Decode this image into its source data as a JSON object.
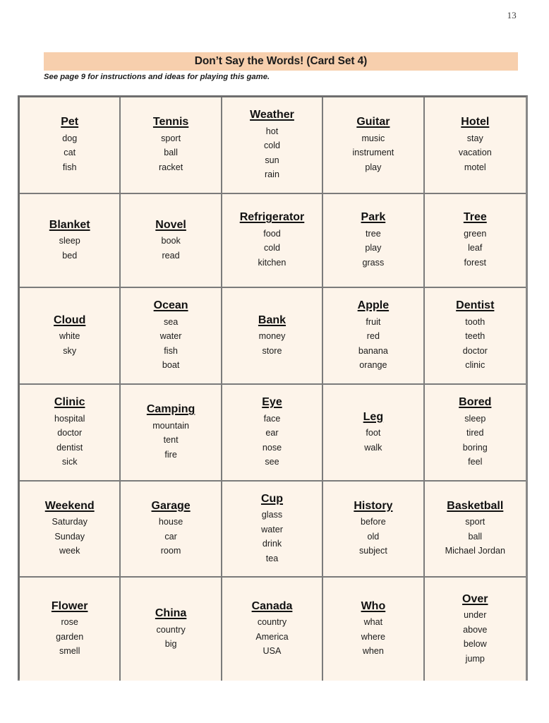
{
  "page": {
    "number": "13",
    "title": "Don’t Say the Words! (Card Set 4)",
    "subtitle": "See page 9 for instructions and ideas for playing this game.",
    "banner_color": "#f7cfad",
    "card_background": "#fdf4ea",
    "border_color": "#7b7b7b"
  },
  "cards": [
    {
      "title": "Pet",
      "words": [
        "dog",
        "cat",
        "fish"
      ]
    },
    {
      "title": "Tennis",
      "words": [
        "sport",
        "ball",
        "racket"
      ]
    },
    {
      "title": "Weather",
      "words": [
        "hot",
        "cold",
        "sun",
        "rain"
      ]
    },
    {
      "title": "Guitar",
      "words": [
        "music",
        "instrument",
        "play"
      ]
    },
    {
      "title": "Hotel",
      "words": [
        "stay",
        "vacation",
        "motel"
      ]
    },
    {
      "title": "Blanket",
      "words": [
        "sleep",
        "bed"
      ]
    },
    {
      "title": "Novel",
      "words": [
        "book",
        "read"
      ]
    },
    {
      "title": "Refrigerator",
      "words": [
        "food",
        "cold",
        "kitchen"
      ]
    },
    {
      "title": "Park",
      "words": [
        "tree",
        "play",
        "grass"
      ]
    },
    {
      "title": "Tree",
      "words": [
        "green",
        "leaf",
        "forest"
      ]
    },
    {
      "title": "Cloud",
      "words": [
        "white",
        "sky"
      ]
    },
    {
      "title": "Ocean",
      "words": [
        "sea",
        "water",
        "fish",
        "boat"
      ]
    },
    {
      "title": "Bank",
      "words": [
        "money",
        "store"
      ]
    },
    {
      "title": "Apple",
      "words": [
        "fruit",
        "red",
        "banana",
        "orange"
      ]
    },
    {
      "title": "Dentist",
      "words": [
        "tooth",
        "teeth",
        "doctor",
        "clinic"
      ]
    },
    {
      "title": "Clinic",
      "words": [
        "hospital",
        "doctor",
        "dentist",
        "sick"
      ]
    },
    {
      "title": "Camping",
      "words": [
        "mountain",
        "tent",
        "fire"
      ]
    },
    {
      "title": "Eye",
      "words": [
        "face",
        "ear",
        "nose",
        "see"
      ]
    },
    {
      "title": "Leg",
      "words": [
        "foot",
        "walk"
      ]
    },
    {
      "title": "Bored",
      "words": [
        "sleep",
        "tired",
        "boring",
        "feel"
      ]
    },
    {
      "title": "Weekend",
      "words": [
        "Saturday",
        "Sunday",
        "week"
      ]
    },
    {
      "title": "Garage",
      "words": [
        "house",
        "car",
        "room"
      ]
    },
    {
      "title": "Cup",
      "words": [
        "glass",
        "water",
        "drink",
        "tea"
      ]
    },
    {
      "title": "History",
      "words": [
        "before",
        "old",
        "subject"
      ]
    },
    {
      "title": "Basketball",
      "words": [
        "sport",
        "ball",
        "Michael Jordan"
      ]
    },
    {
      "title": "Flower",
      "words": [
        "rose",
        "garden",
        "smell"
      ]
    },
    {
      "title": "China",
      "words": [
        "country",
        "big"
      ]
    },
    {
      "title": "Canada",
      "words": [
        "country",
        "America",
        "USA"
      ]
    },
    {
      "title": "Who",
      "words": [
        "what",
        "where",
        "when"
      ]
    },
    {
      "title": "Over",
      "words": [
        "under",
        "above",
        "below",
        "jump"
      ]
    }
  ]
}
